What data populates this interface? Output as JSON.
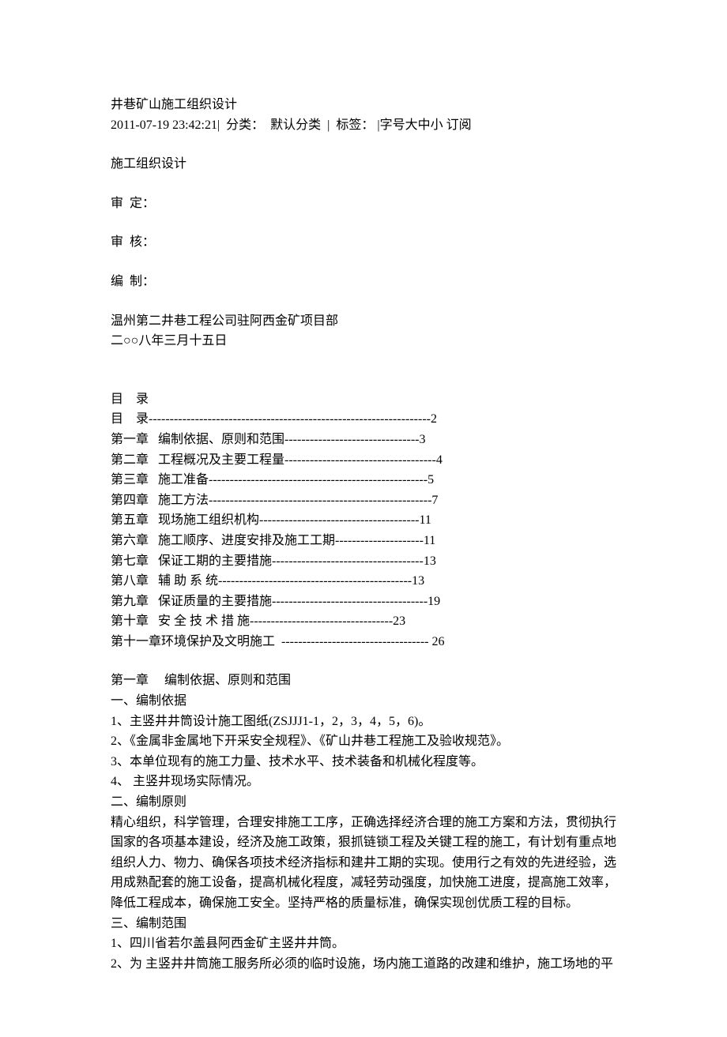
{
  "title": "井巷矿山施工组织设计",
  "meta_line": "2011-07-19 23:42:21|  分类：  默认分类  |  标签： |字号大中小 订阅",
  "heading1": "施工组织设计",
  "approval": [
    "审  定：",
    "审  核：",
    "编  制："
  ],
  "org": "温州第二井巷工程公司驻阿西金矿项目部",
  "date": "二○○八年三月十五日",
  "toc_title": "目    录",
  "toc": [
    "目    录-------------------------------------------------------------------2",
    "第一章   编制依据、原则和范围--------------------------------3",
    "第二章   工程概况及主要工程量------------------------------------4",
    "第三章   施工准备----------------------------------------------------5",
    "第四章   施工方法-----------------------------------------------------7",
    "第五章   现场施工组织机构--------------------------------------11",
    "第六章   施工顺序、进度安排及施工工期---------------------11",
    "第七章   保证工期的主要措施------------------------------------13",
    "第八章   辅 助 系 统----------------------------------------------13",
    "第九章   保证质量的主要措施-------------------------------------19",
    "第十章   安 全 技 术 措 施----------------------------------23",
    "第十一章环境保护及文明施工  ----------------------------------- 26"
  ],
  "ch1_title": "第一章     编制依据、原则和范围",
  "sec1_title": "一、编制依据",
  "sec1_items": [
    "1、主竖井井筒设计施工图纸(ZSJJJ1-1，2，3，4，5，6)。",
    "2、《金属非金属地下开采安全规程》、《矿山井巷工程施工及验收规范》。",
    "3、本单位现有的施工力量、技术水平、技术装备和机械化程度等。",
    "4、 主竖井现场实际情况。"
  ],
  "sec2_title": "二、编制原则",
  "sec2_body": "精心组织，科学管理，合理安排施工工序，正确选择经济合理的施工方案和方法，贯彻执行国家的各项基本建设，经济及施工政策，狠抓链锁工程及关键工程的施工，有计划有重点地组织人力、物力、确保各项技术经济指标和建井工期的实现。使用行之有效的先进经验，选用成熟配套的施工设备，提高机械化程度，减轻劳动强度，加快施工进度，提高施工效率，降低工程成本，确保施工安全。坚持严格的质量标准，确保实现创优质工程的目标。",
  "sec3_title": "三、编制范围",
  "sec3_items": [
    "1、四川省若尔盖县阿西金矿主竖井井筒。",
    "2、为 主竖井井筒施工服务所必须的临时设施，场内施工道路的改建和维护，施工场地的平"
  ]
}
